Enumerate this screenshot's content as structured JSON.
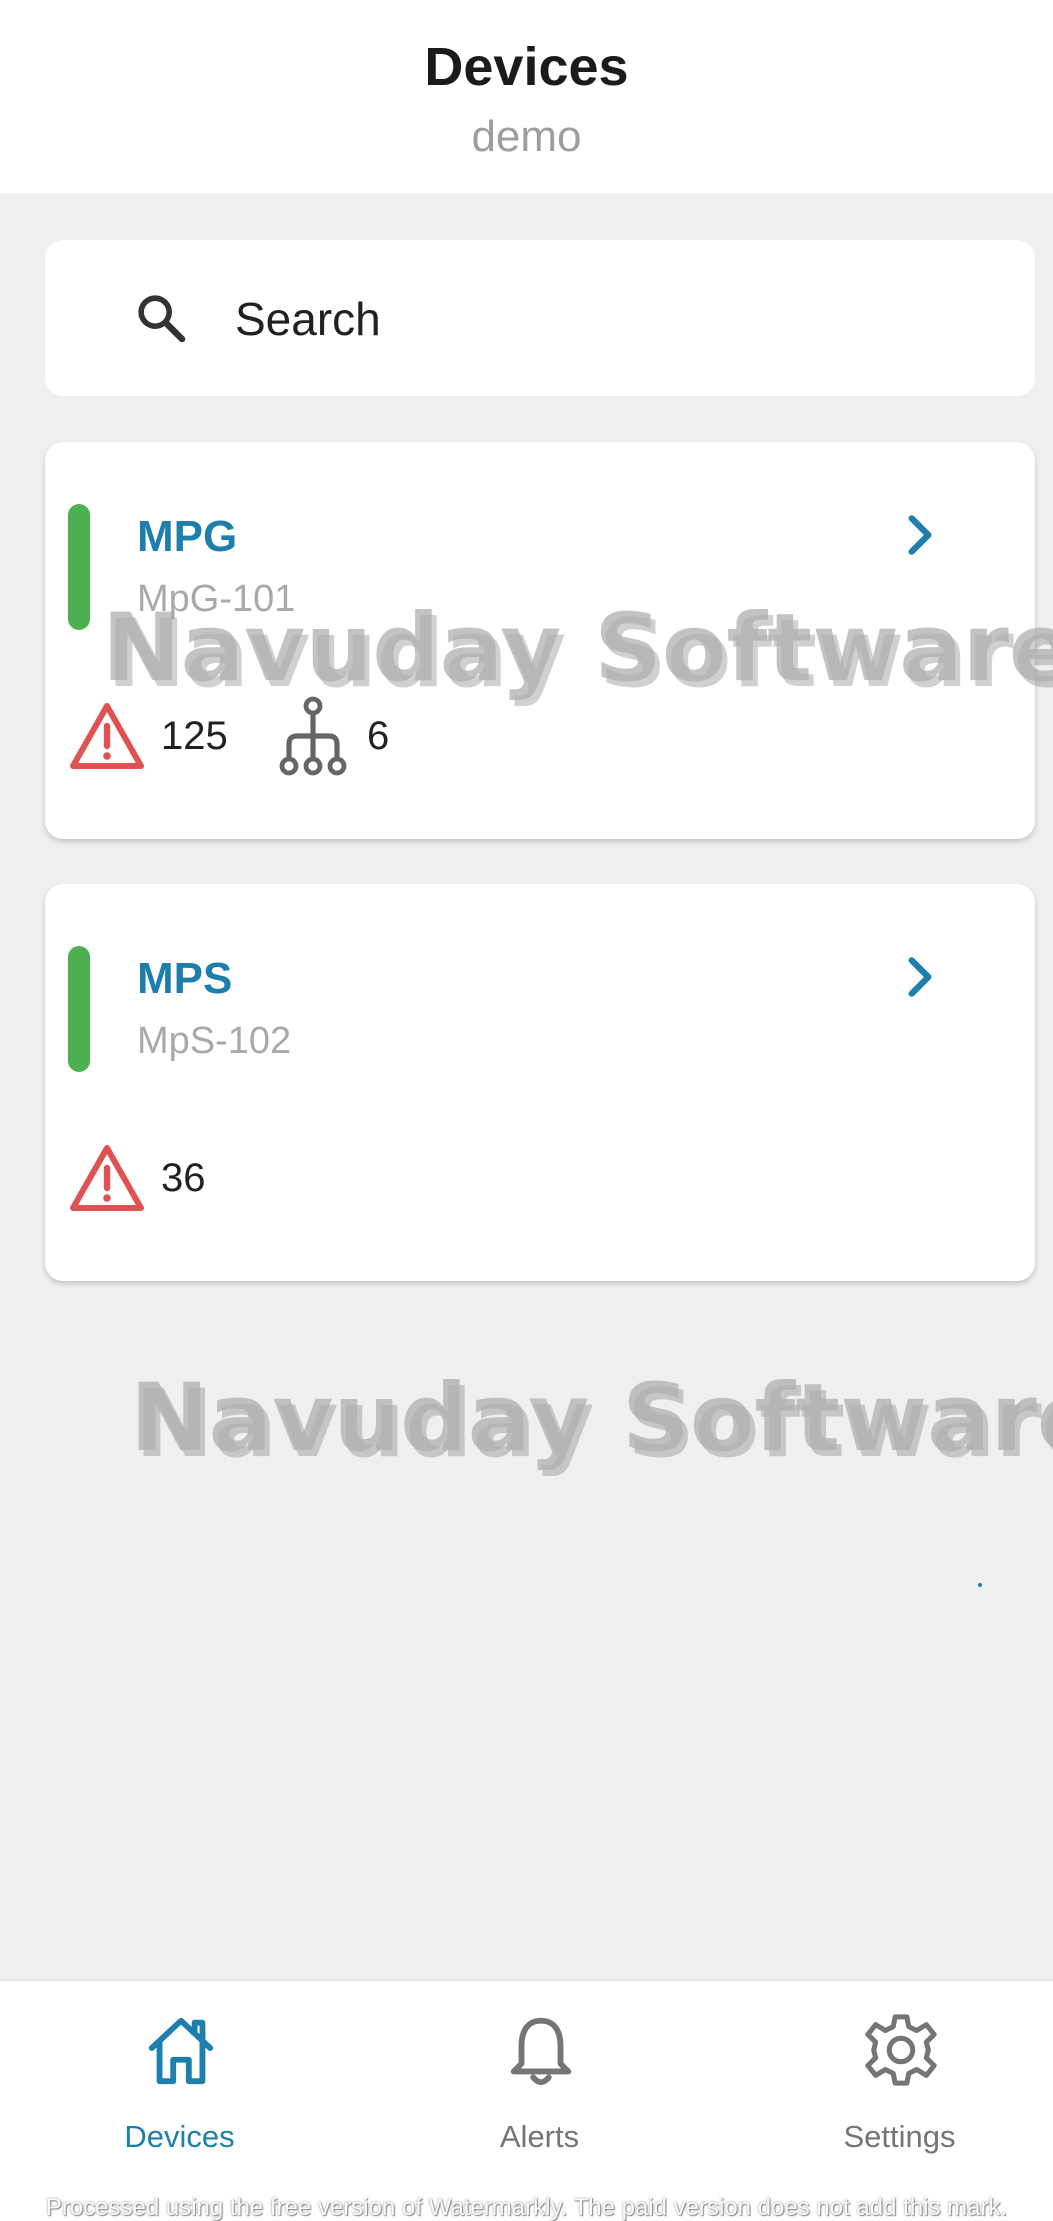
{
  "header": {
    "title": "Devices",
    "subtitle": "demo"
  },
  "search": {
    "placeholder": "Search",
    "icon": "search-icon"
  },
  "devices": [
    {
      "name": "MPG",
      "code": "MpG-101",
      "status_color": "#4caf50",
      "alert_count": "125",
      "node_count": "6"
    },
    {
      "name": "MPS",
      "code": "MpS-102",
      "status_color": "#4caf50",
      "alert_count": "36"
    }
  ],
  "watermark": {
    "text": "Navuday Software",
    "footer": "Processed using the free version of Watermarkly. The paid version does not add this mark."
  },
  "bottom_nav": {
    "items": [
      {
        "label": "Devices",
        "icon": "home-icon",
        "active": true
      },
      {
        "label": "Alerts",
        "icon": "bell-icon",
        "active": false
      },
      {
        "label": "Settings",
        "icon": "gear-icon",
        "active": false
      }
    ]
  },
  "colors": {
    "accent": "#1e7fad",
    "alert": "#e05252",
    "status_ok": "#4caf50"
  }
}
